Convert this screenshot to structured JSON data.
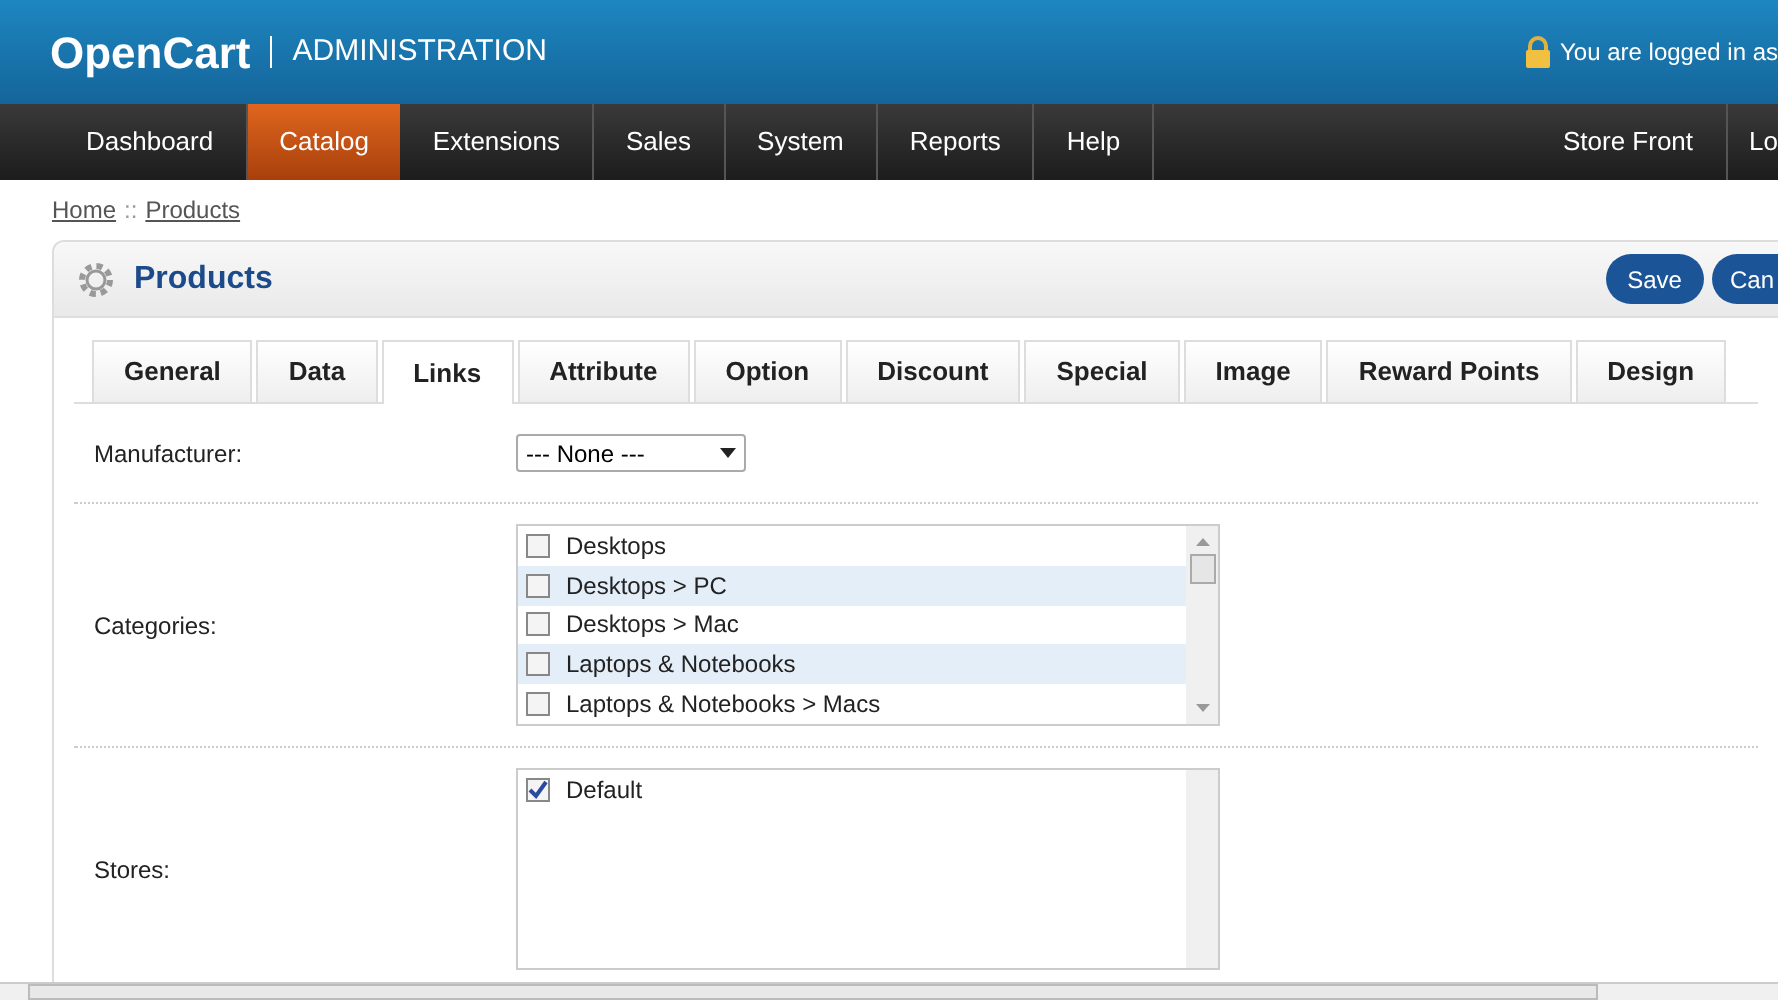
{
  "header": {
    "logo": "OpenCart",
    "subtitle": "ADMINISTRATION",
    "login_text": "You are logged in as"
  },
  "nav": {
    "items": [
      {
        "label": "Dashboard",
        "selected": false
      },
      {
        "label": "Catalog",
        "selected": true
      },
      {
        "label": "Extensions",
        "selected": false
      },
      {
        "label": "Sales",
        "selected": false
      },
      {
        "label": "System",
        "selected": false
      },
      {
        "label": "Reports",
        "selected": false
      },
      {
        "label": "Help",
        "selected": false
      }
    ],
    "right_items": [
      "Store Front",
      "Lo"
    ]
  },
  "breadcrumb": [
    "Home",
    "Products"
  ],
  "breadcrumb_separator": "::",
  "panel": {
    "title": "Products",
    "buttons": [
      "Save",
      "Can"
    ]
  },
  "tabs": [
    {
      "label": "General",
      "selected": false
    },
    {
      "label": "Data",
      "selected": false
    },
    {
      "label": "Links",
      "selected": true
    },
    {
      "label": "Attribute",
      "selected": false
    },
    {
      "label": "Option",
      "selected": false
    },
    {
      "label": "Discount",
      "selected": false
    },
    {
      "label": "Special",
      "selected": false
    },
    {
      "label": "Image",
      "selected": false
    },
    {
      "label": "Reward Points",
      "selected": false
    },
    {
      "label": "Design",
      "selected": false
    }
  ],
  "form": {
    "manufacturer": {
      "label": "Manufacturer:",
      "value": "--- None ---"
    },
    "categories": {
      "label": "Categories:",
      "items": [
        {
          "label": "Desktops",
          "checked": false
        },
        {
          "label": "Desktops > PC",
          "checked": false
        },
        {
          "label": "Desktops > Mac",
          "checked": false
        },
        {
          "label": "Laptops & Notebooks",
          "checked": false
        },
        {
          "label": "Laptops & Notebooks > Macs",
          "checked": false
        }
      ]
    },
    "stores": {
      "label": "Stores:",
      "items": [
        {
          "label": "Default",
          "checked": true
        }
      ]
    }
  }
}
